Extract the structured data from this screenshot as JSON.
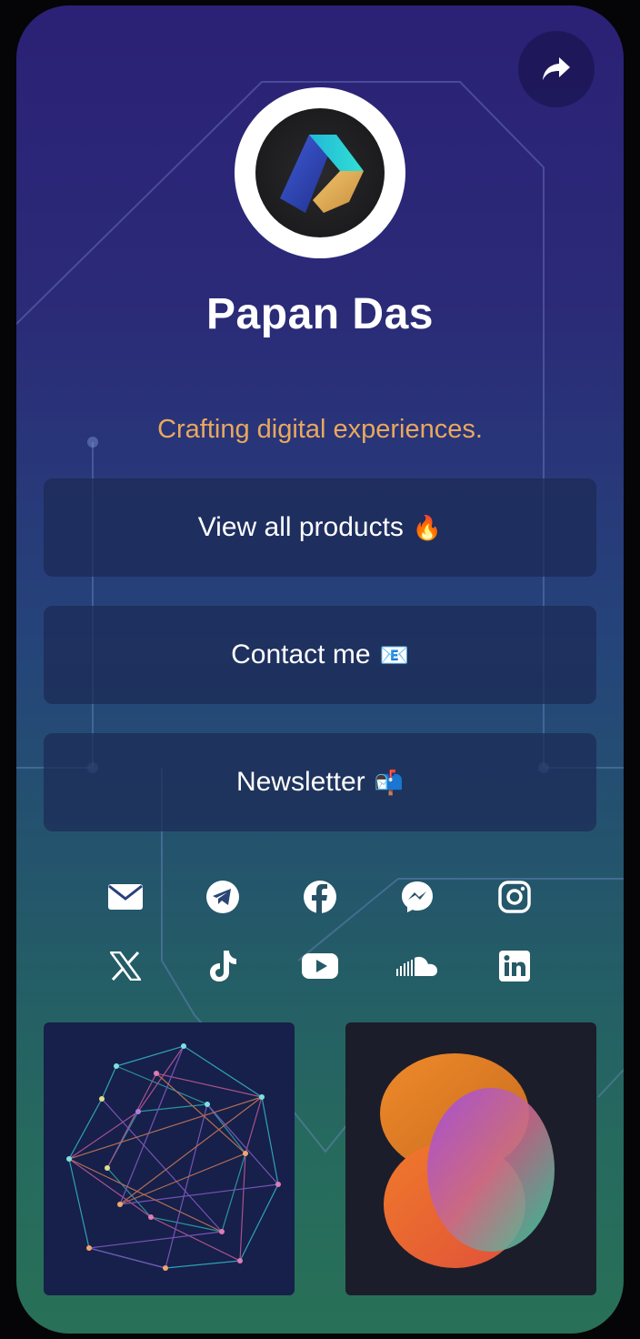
{
  "profile": {
    "name": "Papan Das",
    "tagline": "Crafting digital experiences.",
    "avatar_icon": "abstract-logo-icon"
  },
  "header": {
    "share_icon": "share-arrow-icon"
  },
  "links": [
    {
      "label": "View all products",
      "emoji": "🔥"
    },
    {
      "label": "Contact me",
      "emoji": "📧"
    },
    {
      "label": "Newsletter",
      "emoji": "📬"
    }
  ],
  "socials": [
    "email",
    "telegram",
    "facebook",
    "messenger",
    "instagram",
    "x",
    "tiktok",
    "youtube",
    "soundcloud",
    "linkedin"
  ],
  "thumbnails": [
    {
      "icon": "network-graph-thumbnail"
    },
    {
      "icon": "gradient-blobs-thumbnail"
    }
  ],
  "colors": {
    "accent": "#e9a85e",
    "button_bg": "#1c2a54",
    "gradient_top": "#2b2176",
    "gradient_bottom": "#287057"
  }
}
